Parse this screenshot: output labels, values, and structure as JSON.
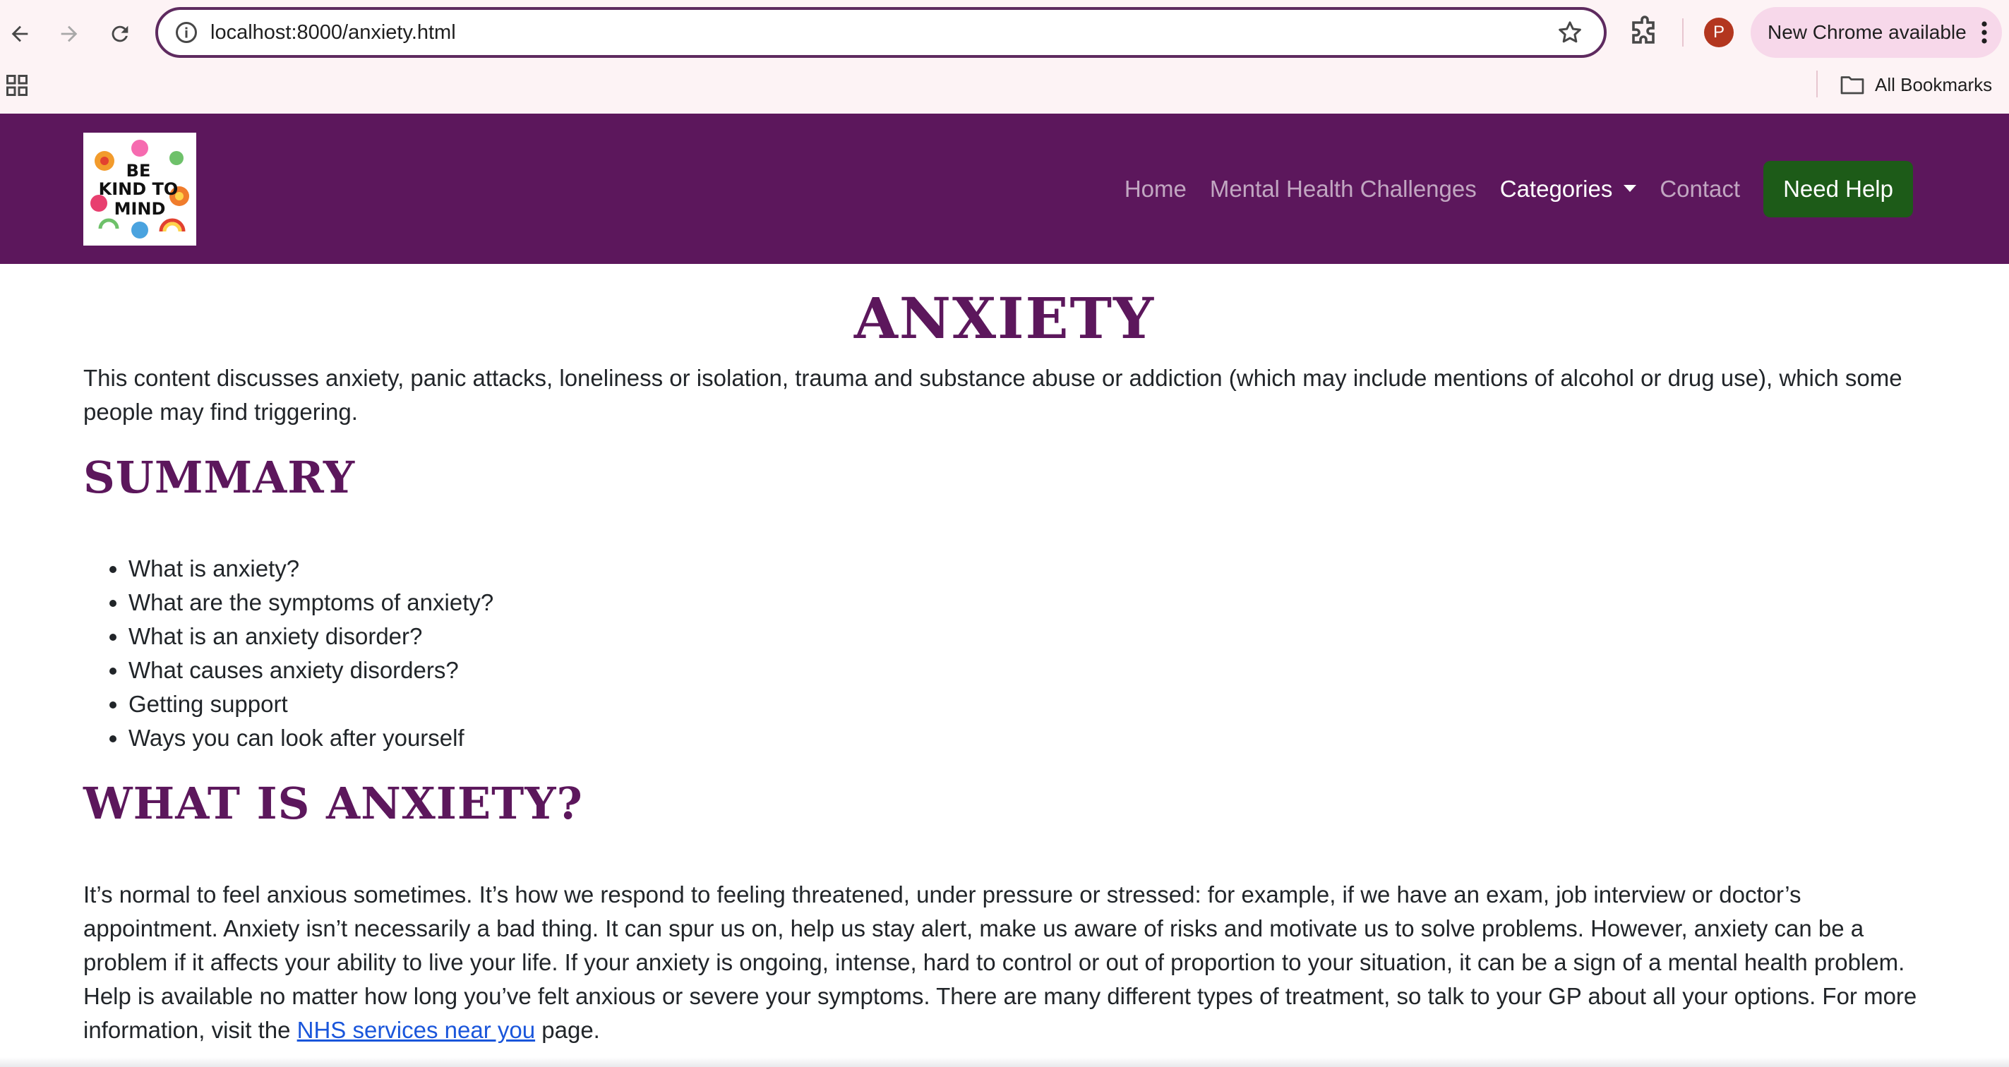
{
  "browser": {
    "url": "localhost:8000/anxiety.html",
    "update_label": "New Chrome available",
    "profile_initial": "P",
    "bookmarks_label": "All Bookmarks",
    "accent": "#5e2a5f"
  },
  "site": {
    "logo_alt": "BE KIND TO YOUR MIND",
    "nav": {
      "home": "Home",
      "challenges": "Mental Health Challenges",
      "categories": "Categories",
      "contact": "Contact",
      "help": "Need Help"
    },
    "colors": {
      "brand": "#5c175c",
      "help_button": "#1d5b18",
      "link": "#1a56db"
    }
  },
  "page": {
    "title": "ANXIETY",
    "warning": "This content discusses anxiety, panic attacks, loneliness or isolation, trauma and substance abuse or addiction (which may include mentions of alcohol or drug use), which some people may find triggering.",
    "summary_heading": "SUMMARY",
    "summary_items": [
      "What is anxiety?",
      "What are the symptoms of anxiety?",
      "What is an anxiety disorder?",
      "What causes anxiety disorders?",
      "Getting support",
      "Ways you can look after yourself"
    ],
    "what_heading": "WHAT IS ANXIETY?",
    "what_para_before": "It’s normal to feel anxious sometimes. It’s how we respond to feeling threatened, under pressure or stressed: for example, if we have an exam, job interview or doctor’s appointment. Anxiety isn’t necessarily a bad thing. It can spur us on, help us stay alert, make us aware of risks and motivate us to solve problems. However, anxiety can be a problem if it affects your ability to live your life. If your anxiety is ongoing, intense, hard to control or out of proportion to your situation, it can be a sign of a mental health problem. Help is available no matter how long you’ve felt anxious or severe your symptoms. There are many different types of treatment, so talk to your GP about all your options. For more information, visit the ",
    "what_para_link": "NHS services near you",
    "what_para_after": " page."
  },
  "icons": [
    "back-arrow-icon",
    "forward-arrow-icon",
    "reload-icon",
    "site-info-icon",
    "bookmark-star-icon",
    "extensions-icon",
    "more-vert-icon",
    "apps-grid-icon",
    "folder-icon",
    "dropdown-caret-icon"
  ]
}
